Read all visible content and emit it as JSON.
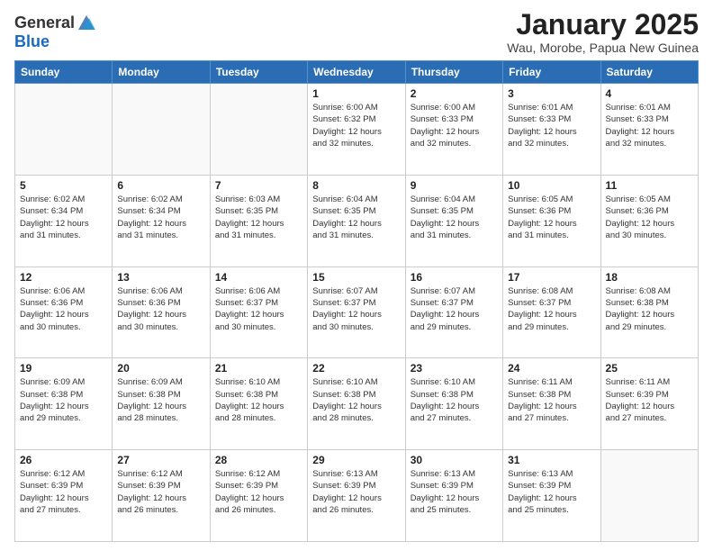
{
  "header": {
    "logo_general": "General",
    "logo_blue": "Blue",
    "month_title": "January 2025",
    "subtitle": "Wau, Morobe, Papua New Guinea"
  },
  "days_of_week": [
    "Sunday",
    "Monday",
    "Tuesday",
    "Wednesday",
    "Thursday",
    "Friday",
    "Saturday"
  ],
  "weeks": [
    [
      {
        "day": "",
        "info": ""
      },
      {
        "day": "",
        "info": ""
      },
      {
        "day": "",
        "info": ""
      },
      {
        "day": "1",
        "info": "Sunrise: 6:00 AM\nSunset: 6:32 PM\nDaylight: 12 hours\nand 32 minutes."
      },
      {
        "day": "2",
        "info": "Sunrise: 6:00 AM\nSunset: 6:33 PM\nDaylight: 12 hours\nand 32 minutes."
      },
      {
        "day": "3",
        "info": "Sunrise: 6:01 AM\nSunset: 6:33 PM\nDaylight: 12 hours\nand 32 minutes."
      },
      {
        "day": "4",
        "info": "Sunrise: 6:01 AM\nSunset: 6:33 PM\nDaylight: 12 hours\nand 32 minutes."
      }
    ],
    [
      {
        "day": "5",
        "info": "Sunrise: 6:02 AM\nSunset: 6:34 PM\nDaylight: 12 hours\nand 31 minutes."
      },
      {
        "day": "6",
        "info": "Sunrise: 6:02 AM\nSunset: 6:34 PM\nDaylight: 12 hours\nand 31 minutes."
      },
      {
        "day": "7",
        "info": "Sunrise: 6:03 AM\nSunset: 6:35 PM\nDaylight: 12 hours\nand 31 minutes."
      },
      {
        "day": "8",
        "info": "Sunrise: 6:04 AM\nSunset: 6:35 PM\nDaylight: 12 hours\nand 31 minutes."
      },
      {
        "day": "9",
        "info": "Sunrise: 6:04 AM\nSunset: 6:35 PM\nDaylight: 12 hours\nand 31 minutes."
      },
      {
        "day": "10",
        "info": "Sunrise: 6:05 AM\nSunset: 6:36 PM\nDaylight: 12 hours\nand 31 minutes."
      },
      {
        "day": "11",
        "info": "Sunrise: 6:05 AM\nSunset: 6:36 PM\nDaylight: 12 hours\nand 30 minutes."
      }
    ],
    [
      {
        "day": "12",
        "info": "Sunrise: 6:06 AM\nSunset: 6:36 PM\nDaylight: 12 hours\nand 30 minutes."
      },
      {
        "day": "13",
        "info": "Sunrise: 6:06 AM\nSunset: 6:36 PM\nDaylight: 12 hours\nand 30 minutes."
      },
      {
        "day": "14",
        "info": "Sunrise: 6:06 AM\nSunset: 6:37 PM\nDaylight: 12 hours\nand 30 minutes."
      },
      {
        "day": "15",
        "info": "Sunrise: 6:07 AM\nSunset: 6:37 PM\nDaylight: 12 hours\nand 30 minutes."
      },
      {
        "day": "16",
        "info": "Sunrise: 6:07 AM\nSunset: 6:37 PM\nDaylight: 12 hours\nand 29 minutes."
      },
      {
        "day": "17",
        "info": "Sunrise: 6:08 AM\nSunset: 6:37 PM\nDaylight: 12 hours\nand 29 minutes."
      },
      {
        "day": "18",
        "info": "Sunrise: 6:08 AM\nSunset: 6:38 PM\nDaylight: 12 hours\nand 29 minutes."
      }
    ],
    [
      {
        "day": "19",
        "info": "Sunrise: 6:09 AM\nSunset: 6:38 PM\nDaylight: 12 hours\nand 29 minutes."
      },
      {
        "day": "20",
        "info": "Sunrise: 6:09 AM\nSunset: 6:38 PM\nDaylight: 12 hours\nand 28 minutes."
      },
      {
        "day": "21",
        "info": "Sunrise: 6:10 AM\nSunset: 6:38 PM\nDaylight: 12 hours\nand 28 minutes."
      },
      {
        "day": "22",
        "info": "Sunrise: 6:10 AM\nSunset: 6:38 PM\nDaylight: 12 hours\nand 28 minutes."
      },
      {
        "day": "23",
        "info": "Sunrise: 6:10 AM\nSunset: 6:38 PM\nDaylight: 12 hours\nand 27 minutes."
      },
      {
        "day": "24",
        "info": "Sunrise: 6:11 AM\nSunset: 6:38 PM\nDaylight: 12 hours\nand 27 minutes."
      },
      {
        "day": "25",
        "info": "Sunrise: 6:11 AM\nSunset: 6:39 PM\nDaylight: 12 hours\nand 27 minutes."
      }
    ],
    [
      {
        "day": "26",
        "info": "Sunrise: 6:12 AM\nSunset: 6:39 PM\nDaylight: 12 hours\nand 27 minutes."
      },
      {
        "day": "27",
        "info": "Sunrise: 6:12 AM\nSunset: 6:39 PM\nDaylight: 12 hours\nand 26 minutes."
      },
      {
        "day": "28",
        "info": "Sunrise: 6:12 AM\nSunset: 6:39 PM\nDaylight: 12 hours\nand 26 minutes."
      },
      {
        "day": "29",
        "info": "Sunrise: 6:13 AM\nSunset: 6:39 PM\nDaylight: 12 hours\nand 26 minutes."
      },
      {
        "day": "30",
        "info": "Sunrise: 6:13 AM\nSunset: 6:39 PM\nDaylight: 12 hours\nand 25 minutes."
      },
      {
        "day": "31",
        "info": "Sunrise: 6:13 AM\nSunset: 6:39 PM\nDaylight: 12 hours\nand 25 minutes."
      },
      {
        "day": "",
        "info": ""
      }
    ]
  ]
}
